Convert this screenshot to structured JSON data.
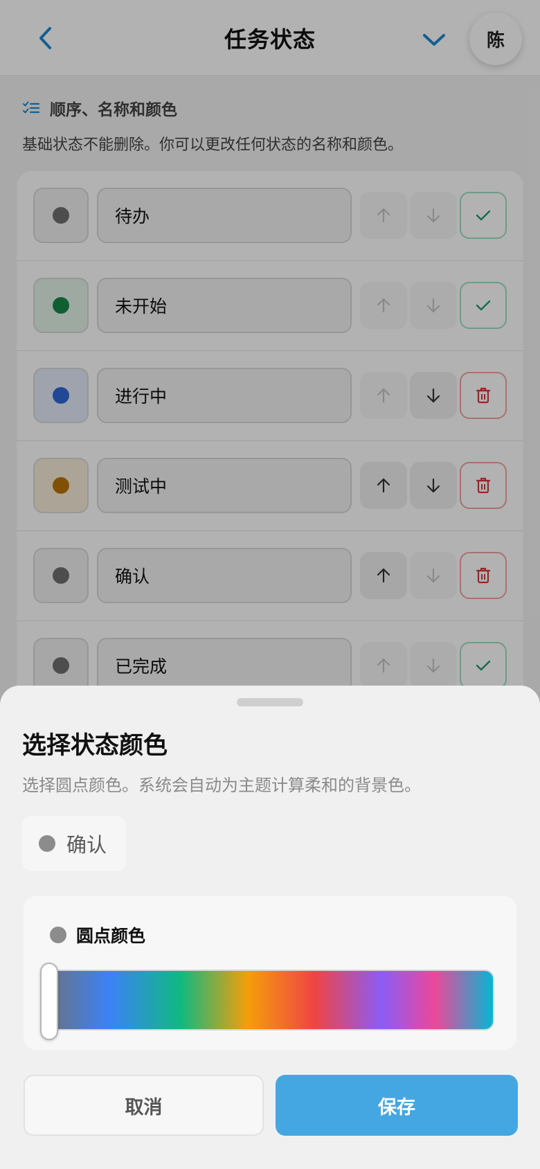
{
  "header": {
    "title": "任务状态",
    "avatar_initial": "陈",
    "accent_color": "#1a88d0"
  },
  "section": {
    "title": "顺序、名称和颜色",
    "description": "基础状态不能删除。你可以更改任何状态的名称和颜色。"
  },
  "statuses": [
    {
      "name": "待办",
      "dot_color": "#6f6f6f",
      "box_tint": "#efefef",
      "up_enabled": false,
      "down_enabled": false,
      "action": "confirm"
    },
    {
      "name": "未开始",
      "dot_color": "#17894a",
      "box_tint": "#e1f2e7",
      "up_enabled": false,
      "down_enabled": false,
      "action": "confirm"
    },
    {
      "name": "进行中",
      "dot_color": "#2e68d6",
      "box_tint": "#e2eaf9",
      "up_enabled": false,
      "down_enabled": true,
      "action": "delete"
    },
    {
      "name": "测试中",
      "dot_color": "#b87507",
      "box_tint": "#f6ecd9",
      "up_enabled": true,
      "down_enabled": true,
      "action": "delete"
    },
    {
      "name": "确认",
      "dot_color": "#6f6f6f",
      "box_tint": "#efefef",
      "up_enabled": true,
      "down_enabled": false,
      "action": "delete"
    },
    {
      "name": "已完成",
      "dot_color": "#6f6f6f",
      "box_tint": "#efefef",
      "up_enabled": false,
      "down_enabled": false,
      "action": "confirm"
    }
  ],
  "sheet": {
    "title": "选择状态颜色",
    "description": "选择圆点颜色。系统会自动为主题计算柔和的背景色。",
    "preview_label": "确认",
    "dot_color_label": "圆点颜色",
    "hue_value": 0,
    "cancel_label": "取消",
    "save_label": "保存",
    "save_color": "#45a7e2"
  }
}
